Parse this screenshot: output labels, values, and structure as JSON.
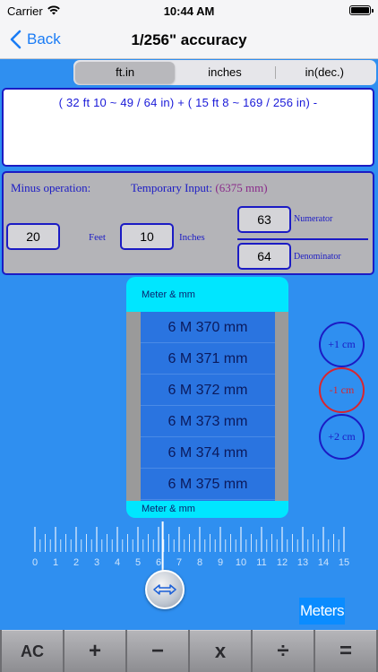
{
  "status": {
    "carrier": "Carrier",
    "time": "10:44 AM"
  },
  "nav": {
    "back_label": "Back",
    "title": "1/256\" accuracy"
  },
  "segment": {
    "items": [
      "ft.in",
      "inches",
      "in(dec.)"
    ],
    "selected": "ft.in"
  },
  "expression": {
    "text": "( 32 ft 10 ~ 49 / 64 in)  +  ( 15 ft 8 ~ 169 / 256 in)  -"
  },
  "operation": {
    "label": "Minus operation:",
    "temp_label": "Temporary Input:",
    "temp_value": "(6375 mm)",
    "feet_value": "20",
    "feet_label": "Feet",
    "inches_value": "10",
    "inches_label": "Inches",
    "numerator_value": "63",
    "numerator_label": "Numerator",
    "denominator_value": "64",
    "denominator_label": "Denominator"
  },
  "picker": {
    "header": "Meter & mm",
    "footer": "Meter & mm",
    "rows": [
      "6 M 370 mm",
      "6 M 371 mm",
      "6 M 372 mm",
      "6 M 373 mm",
      "6 M 374 mm",
      "6 M 375 mm"
    ]
  },
  "adjust": {
    "plus1": "+1 cm",
    "minus1": "-1 cm",
    "plus2": "+2 cm"
  },
  "ruler": {
    "labels": [
      "0",
      "1",
      "2",
      "3",
      "4",
      "5",
      "6",
      "7",
      "8",
      "9",
      "10",
      "11",
      "12",
      "13",
      "14",
      "15"
    ],
    "pointer_value": 6.2
  },
  "unit_badge": "Meters",
  "keypad": {
    "ac": "AC",
    "plus": "+",
    "minus": "−",
    "multiply": "x",
    "divide": "÷",
    "equals": "="
  },
  "colors": {
    "background": "#2f8ff0",
    "accent": "#1b1bc4",
    "picker_bg": "#00e6ff",
    "minus_btn": "#d8252f"
  }
}
